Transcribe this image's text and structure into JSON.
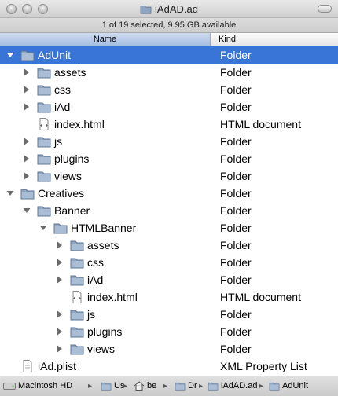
{
  "window": {
    "title": "iAdAD.ad",
    "status": "1 of 19 selected, 9.95 GB available"
  },
  "columns": {
    "name": "Name",
    "kind": "Kind"
  },
  "rows": [
    {
      "label": "AdUnit",
      "kind": "Folder",
      "icon": "folder-icon",
      "expanded": true,
      "selected": true
    },
    {
      "label": "assets",
      "kind": "Folder",
      "icon": "folder-icon",
      "expanded": false
    },
    {
      "label": "css",
      "kind": "Folder",
      "icon": "folder-icon",
      "expanded": false
    },
    {
      "label": "iAd",
      "kind": "Folder",
      "icon": "folder-icon",
      "expanded": false
    },
    {
      "label": "index.html",
      "kind": "HTML document",
      "icon": "html-file-icon"
    },
    {
      "label": "js",
      "kind": "Folder",
      "icon": "folder-icon",
      "expanded": false
    },
    {
      "label": "plugins",
      "kind": "Folder",
      "icon": "folder-icon",
      "expanded": false
    },
    {
      "label": "views",
      "kind": "Folder",
      "icon": "folder-icon",
      "expanded": false
    },
    {
      "label": "Creatives",
      "kind": "Folder",
      "icon": "folder-icon",
      "expanded": true
    },
    {
      "label": "Banner",
      "kind": "Folder",
      "icon": "folder-icon",
      "expanded": true
    },
    {
      "label": "HTMLBanner",
      "kind": "Folder",
      "icon": "folder-icon",
      "expanded": true
    },
    {
      "label": "assets",
      "kind": "Folder",
      "icon": "folder-icon",
      "expanded": false
    },
    {
      "label": "css",
      "kind": "Folder",
      "icon": "folder-icon",
      "expanded": false
    },
    {
      "label": "iAd",
      "kind": "Folder",
      "icon": "folder-icon",
      "expanded": false
    },
    {
      "label": "index.html",
      "kind": "HTML document",
      "icon": "html-file-icon"
    },
    {
      "label": "js",
      "kind": "Folder",
      "icon": "folder-icon",
      "expanded": false
    },
    {
      "label": "plugins",
      "kind": "Folder",
      "icon": "folder-icon",
      "expanded": false
    },
    {
      "label": "views",
      "kind": "Folder",
      "icon": "folder-icon",
      "expanded": false
    },
    {
      "label": "iAd.plist",
      "kind": "XML Property List",
      "icon": "plist-file-icon"
    }
  ],
  "pathbar": [
    {
      "label": "Macintosh HD",
      "icon": "hard-disk-icon"
    },
    {
      "label": "Us",
      "icon": "folder-icon"
    },
    {
      "label": "be",
      "icon": "home-icon"
    },
    {
      "label": "Dr",
      "icon": "folder-icon"
    },
    {
      "label": "iAdAD.ad",
      "icon": "folder-icon"
    },
    {
      "label": "AdUnit",
      "icon": "folder-icon"
    }
  ],
  "colors": {
    "selection": "#3875d7",
    "folder": "#8fa6c2"
  }
}
